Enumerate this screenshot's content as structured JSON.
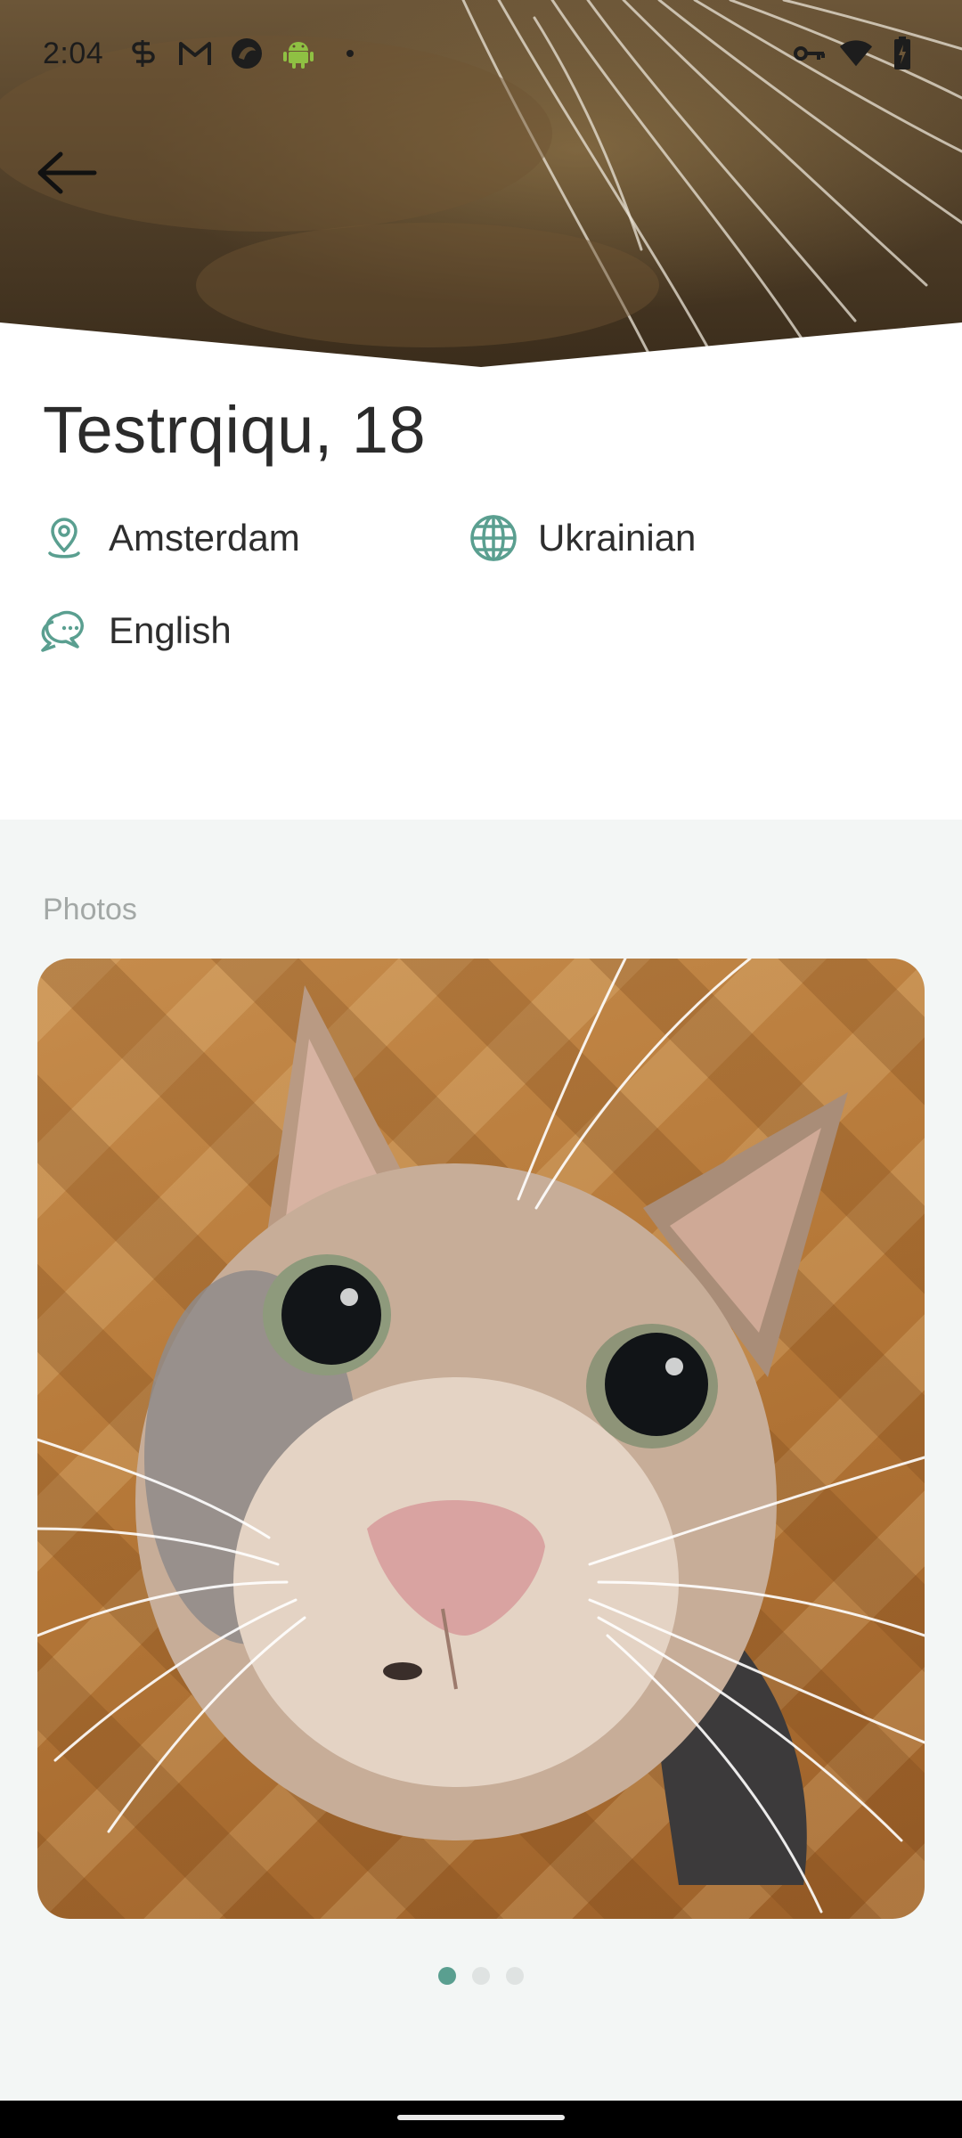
{
  "status_bar": {
    "time": "2:04",
    "left_icons": [
      "s-icon",
      "gmail-icon",
      "dolphin-icon",
      "android-icon",
      "dot-icon"
    ],
    "right_icons": [
      "key-icon",
      "wifi-icon",
      "battery-icon"
    ]
  },
  "header": {
    "back_icon": "arrow-left-icon"
  },
  "profile": {
    "name_age": "Testrqiqu, 18",
    "location": "Amsterdam",
    "nationality": "Ukrainian",
    "language": "English"
  },
  "photos": {
    "title": "Photos",
    "page_count": 3,
    "active_page": 1
  },
  "colors": {
    "accent": "#5a9f90",
    "section_bg": "#f3f6f5"
  }
}
